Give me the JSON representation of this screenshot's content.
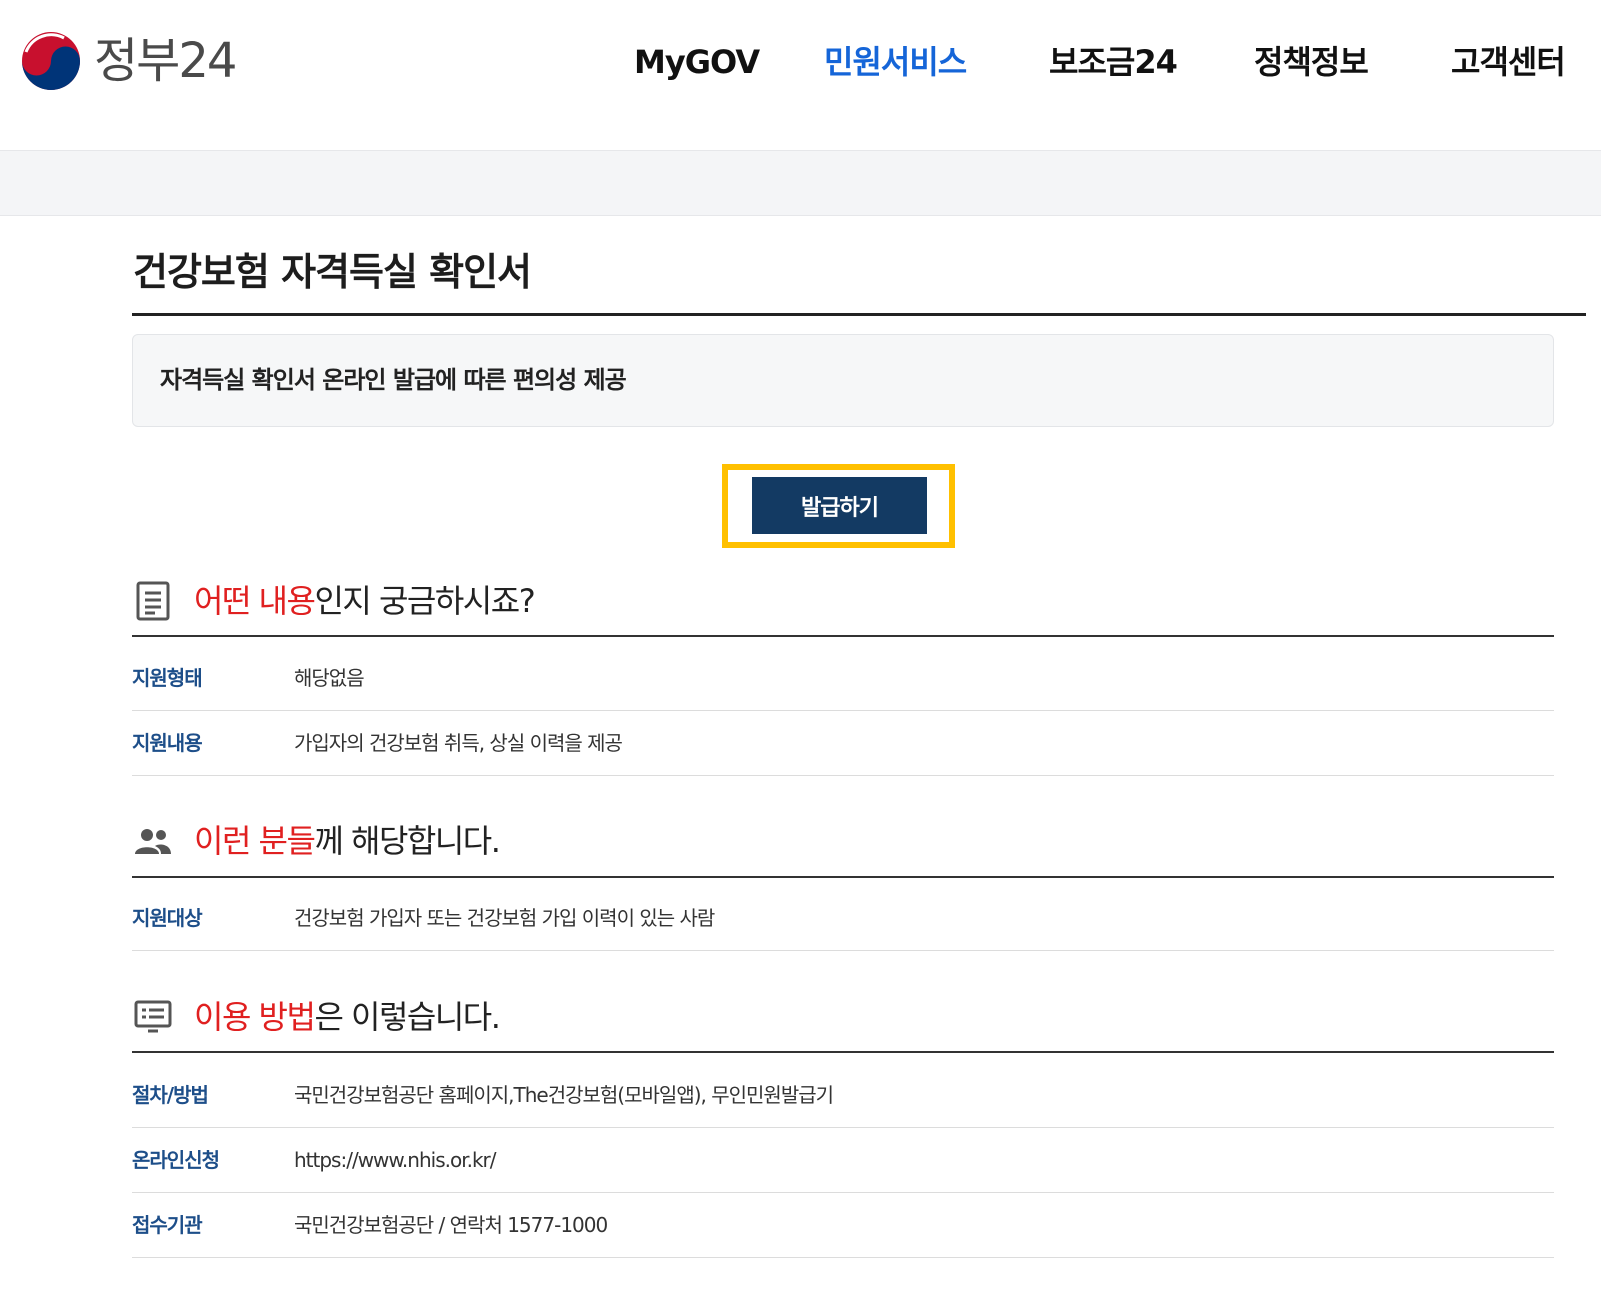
{
  "header": {
    "logo_text": "정부24",
    "nav": [
      {
        "label": "MyGOV",
        "active": false
      },
      {
        "label": "민원서비스",
        "active": true
      },
      {
        "label": "보조금24",
        "active": false
      },
      {
        "label": "정책정보",
        "active": false
      },
      {
        "label": "고객센터",
        "active": false
      }
    ],
    "active_color": "#1565d8"
  },
  "page": {
    "title": "건강보험 자격득실 확인서",
    "summary": "자격득실 확인서 온라인 발급에 따른 편의성 제공",
    "issue_button": "발급하기",
    "highlight_color": "#ffc000",
    "button_color": "#133a63"
  },
  "sections": {
    "content": {
      "icon": "document-icon",
      "title_highlight": "어떤 내용",
      "title_rest": "인지 궁금하시죠?",
      "rows": [
        {
          "label": "지원형태",
          "value": "해당없음"
        },
        {
          "label": "지원내용",
          "value": "가입자의 건강보험 취득, 상실 이력을 제공"
        }
      ]
    },
    "target": {
      "icon": "people-icon",
      "title_highlight": "이런 분들",
      "title_rest": "께 해당합니다.",
      "rows": [
        {
          "label": "지원대상",
          "value": "건강보험 가입자 또는 건강보험 가입 이력이 있는 사람"
        }
      ]
    },
    "method": {
      "icon": "list-screen-icon",
      "title_highlight": "이용 방법",
      "title_rest": "은 이렇습니다.",
      "rows": [
        {
          "label": "절차/방법",
          "value": "국민건강보험공단 홈페이지,The건강보험(모바일앱), 무인민원발급기"
        },
        {
          "label": "온라인신청",
          "value": "https://www.nhis.or.kr/"
        },
        {
          "label": "접수기관",
          "value": "국민건강보험공단 / 연락처 1577-1000"
        }
      ]
    }
  }
}
